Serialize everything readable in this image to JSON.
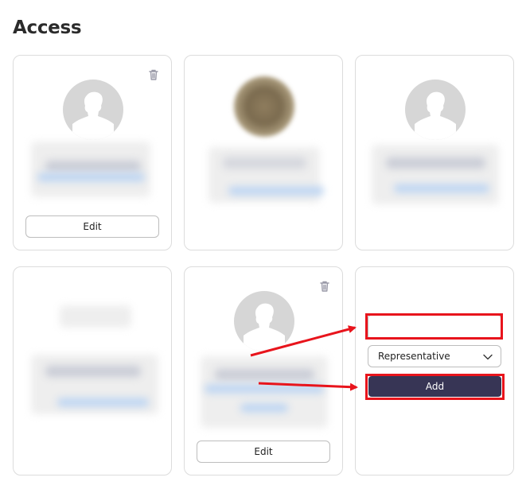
{
  "page": {
    "title": "Access"
  },
  "members": [
    {
      "edit_label": "Edit",
      "avatar": "placeholder"
    },
    {
      "avatar": "photo"
    },
    {
      "avatar": "placeholder"
    },
    {
      "avatar": "none"
    },
    {
      "edit_label": "Edit",
      "avatar": "placeholder"
    }
  ],
  "add_member": {
    "email_value": "",
    "role_selected": "Representative",
    "add_label": "Add"
  },
  "colors": {
    "add_button": "#373555",
    "annotation": "#e8141c"
  },
  "icons": {
    "delete": "trash-icon",
    "dropdown": "chevron-down-icon",
    "avatar_placeholder": "user-silhouette-icon"
  }
}
